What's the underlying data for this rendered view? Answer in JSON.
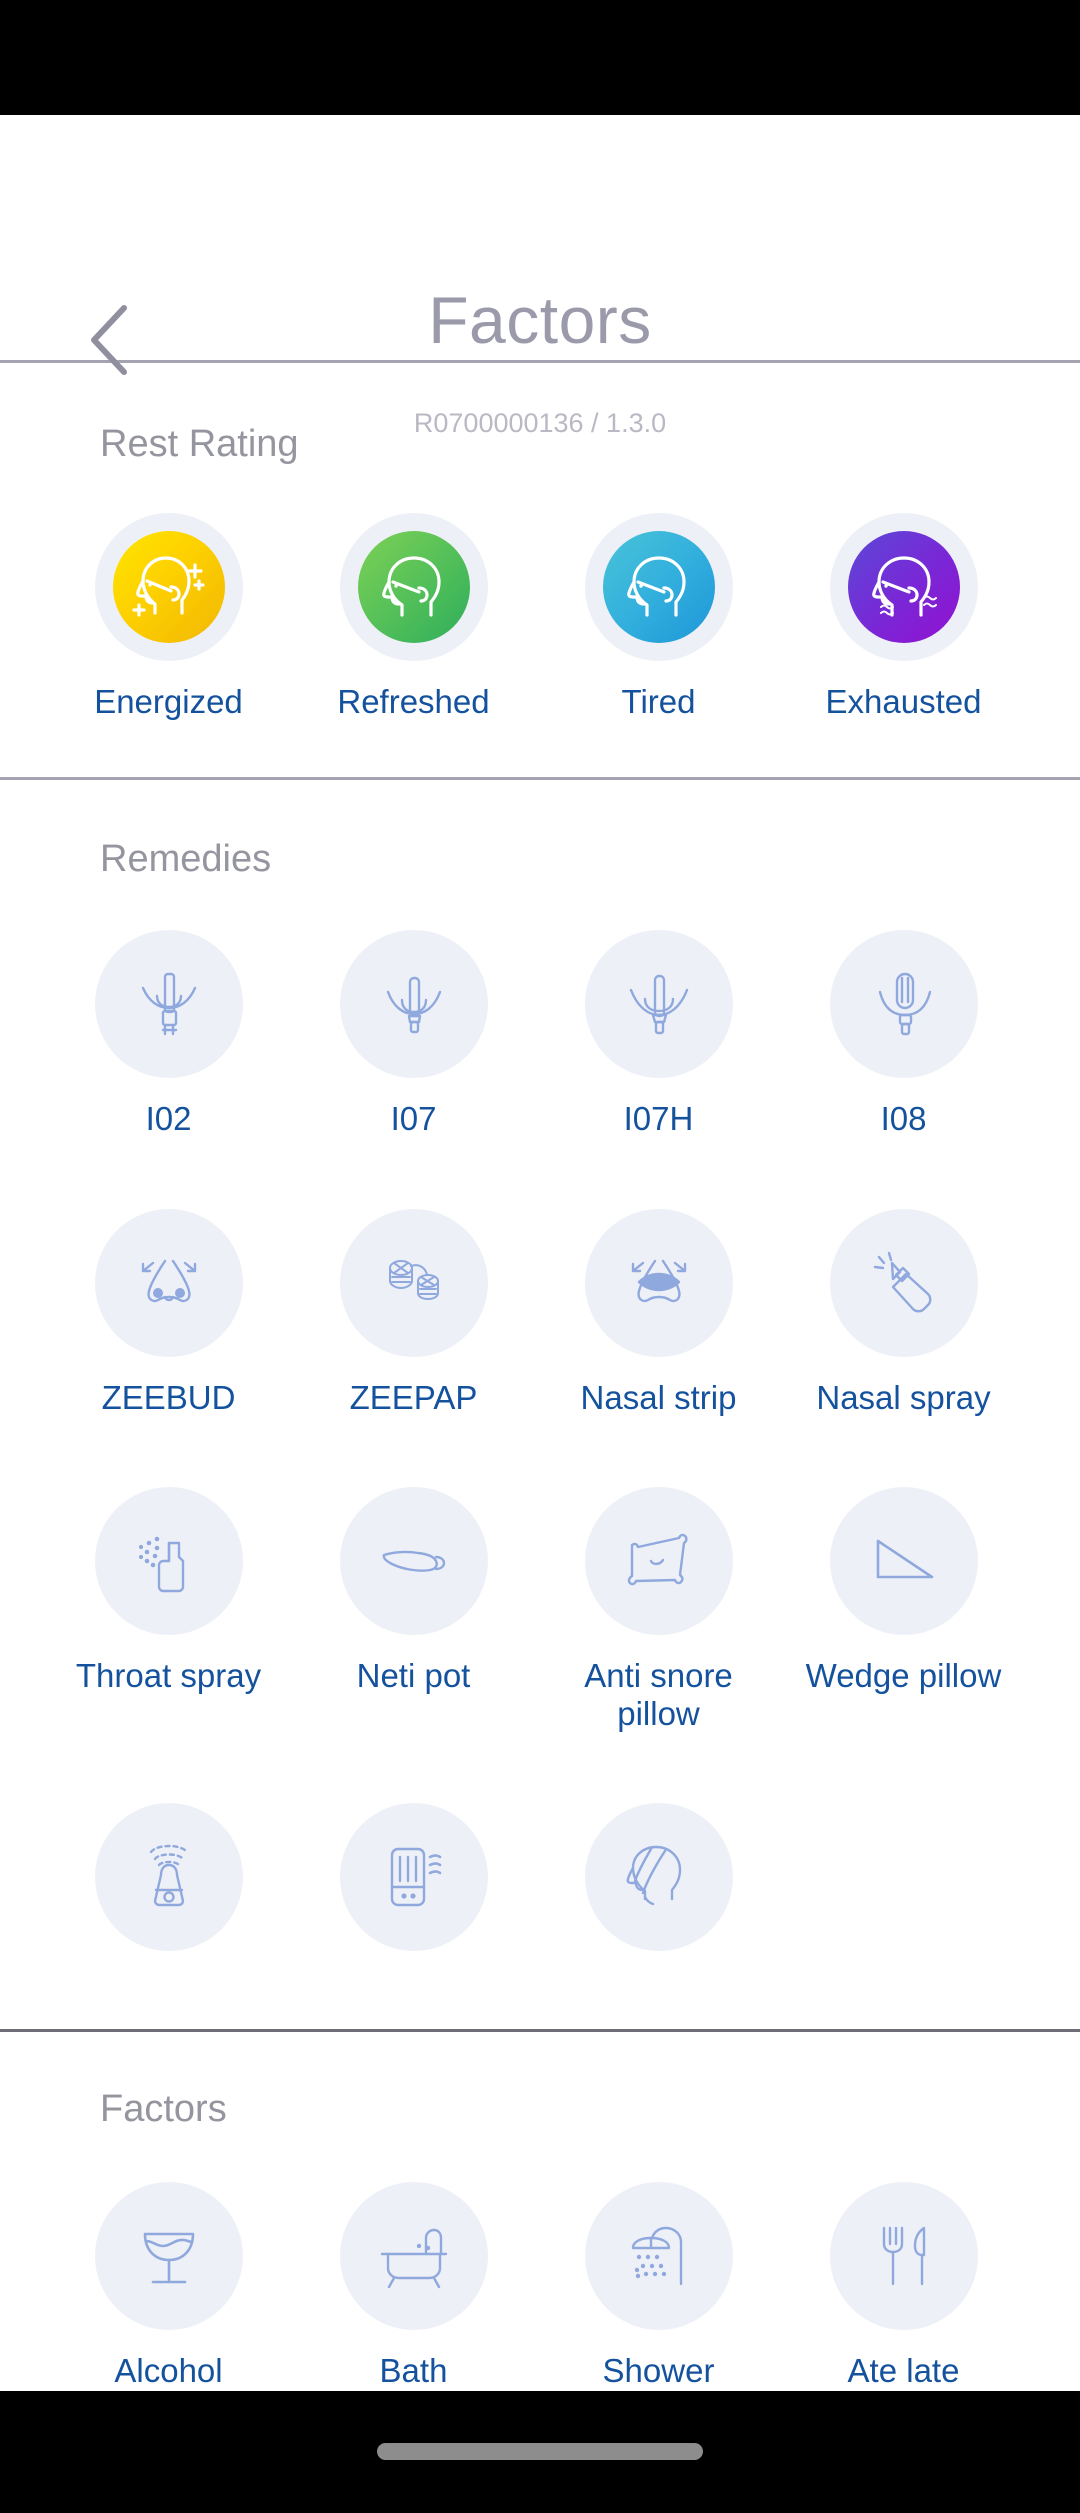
{
  "header": {
    "title": "Factors",
    "subtitle": "R0700000136 / 1.3.0",
    "back_icon": "chevron-left-icon"
  },
  "colors": {
    "label_blue": "#14529e",
    "section_gray": "#95959f",
    "title_gray": "#9a9aab",
    "icon_bg": "#eef0f7",
    "icon_stroke": "#8fa8dd",
    "divider": "#a3a3b2",
    "energized": "#ffd400",
    "refreshed": "#4cbd57",
    "tired": "#2bb0da",
    "exhausted": "#7a27d6"
  },
  "sections": [
    {
      "title": "Rest Rating",
      "items": [
        {
          "label": "Energized",
          "icon": "head-sparkle-icon",
          "color_key": "yellow"
        },
        {
          "label": "Refreshed",
          "icon": "head-icon",
          "color_key": "green"
        },
        {
          "label": "Tired",
          "icon": "head-icon",
          "color_key": "teal"
        },
        {
          "label": "Exhausted",
          "icon": "head-waves-icon",
          "color_key": "purple"
        }
      ]
    },
    {
      "title": "Remedies",
      "items": [
        {
          "label": "I02",
          "icon": "cpap-mask-i02-icon"
        },
        {
          "label": "I07",
          "icon": "cpap-mask-i07-icon"
        },
        {
          "label": "I07H",
          "icon": "cpap-mask-i07h-icon"
        },
        {
          "label": "I08",
          "icon": "cpap-mask-i08-icon"
        },
        {
          "label": "ZEEBUD",
          "icon": "nose-dilator-icon"
        },
        {
          "label": "ZEEPAP",
          "icon": "nasal-pillow-icon"
        },
        {
          "label": "Nasal strip",
          "icon": "nasal-strip-icon"
        },
        {
          "label": "Nasal spray",
          "icon": "nasal-spray-icon"
        },
        {
          "label": "Throat spray",
          "icon": "throat-spray-icon"
        },
        {
          "label": "Neti pot",
          "icon": "neti-pot-icon"
        },
        {
          "label": "Anti snore pillow",
          "icon": "anti-snore-pillow-icon"
        },
        {
          "label": "Wedge pillow",
          "icon": "wedge-pillow-icon"
        },
        {
          "label": "",
          "icon": "humidifier-icon"
        },
        {
          "label": "",
          "icon": "air-purifier-icon"
        },
        {
          "label": "",
          "icon": "chin-strap-icon"
        }
      ]
    },
    {
      "title": "Factors",
      "items": [
        {
          "label": "Alcohol",
          "icon": "wine-glass-icon"
        },
        {
          "label": "Bath",
          "icon": "bathtub-icon"
        },
        {
          "label": "Shower",
          "icon": "shower-icon"
        },
        {
          "label": "Ate late",
          "icon": "fork-knife-icon"
        }
      ]
    }
  ]
}
